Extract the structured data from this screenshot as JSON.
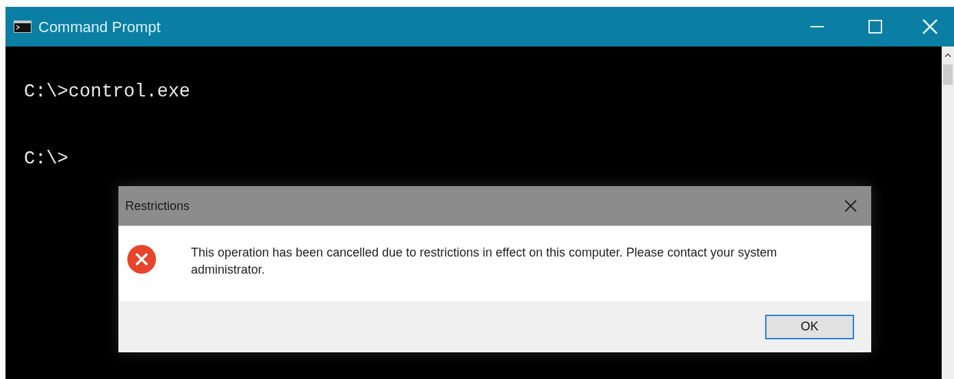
{
  "window": {
    "title": "Command Prompt"
  },
  "console": {
    "lines": [
      "C:\\>control.exe",
      "C:\\>"
    ]
  },
  "dialog": {
    "title": "Restrictions",
    "message": "This operation has been cancelled due to restrictions in effect on this computer. Please contact your system administrator.",
    "buttons": [
      "OK"
    ]
  }
}
